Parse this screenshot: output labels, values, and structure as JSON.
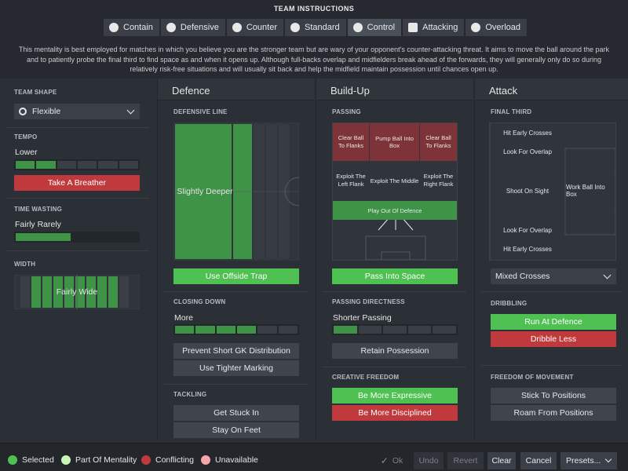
{
  "title": "TEAM INSTRUCTIONS",
  "tabs": [
    {
      "label": "Contain"
    },
    {
      "label": "Defensive"
    },
    {
      "label": "Counter"
    },
    {
      "label": "Standard"
    },
    {
      "label": "Control"
    },
    {
      "label": "Attacking"
    },
    {
      "label": "Overload"
    }
  ],
  "description_lines": [
    "This mentality is best employed for matches in which you believe you are the stronger team but are wary of your opponent's counter-attacking threat. It aims to move the ball around the park",
    "and to patiently probe the final third to find space as and when it opens up. Although full-backs overlap and midfielders break ahead of the forwards, they will generally only do so during",
    "relatively risk-free situations and will usually sit back and help the midfield maintain possession until chances open up."
  ],
  "left": {
    "team_shape_label": "TEAM SHAPE",
    "team_shape_value": "Flexible",
    "tempo_label": "TEMPO",
    "tempo_value": "Lower",
    "tempo_level": 2,
    "tempo_segments": 6,
    "tempo_button": "Take A Breather",
    "time_wasting_label": "TIME WASTING",
    "time_wasting_value": "Fairly Rarely",
    "time_wasting_level": 0.45,
    "width_label": "WIDTH",
    "width_value": "Fairly Wide"
  },
  "defence": {
    "header": "Defence",
    "line_label": "DEFENSIVE LINE",
    "line_value": "Slightly Deeper",
    "offside_button": "Use Offside Trap",
    "closing_label": "CLOSING DOWN",
    "closing_value": "More",
    "closing_level": 4,
    "closing_segments": 6,
    "buttons": [
      "Prevent Short GK Distribution",
      "Use Tighter Marking"
    ],
    "tackling_label": "TACKLING",
    "tackling_buttons": [
      "Get Stuck In",
      "Stay On Feet"
    ]
  },
  "buildup": {
    "header": "Build-Up",
    "passing_label": "PASSING",
    "zones_top": [
      "Clear Ball To Flanks",
      "Pump Ball Into Box",
      "Clear Ball To Flanks"
    ],
    "zones_mid": [
      "Exploit The Left Flank",
      "Exploit The Middle",
      "Exploit The Right Flank"
    ],
    "zone_bottom": "Play Out Of Defence",
    "space_button": "Pass Into Space",
    "directness_label": "PASSING DIRECTNESS",
    "directness_value": "Shorter Passing",
    "directness_level": 1,
    "directness_segments": 5,
    "retain_button": "Retain Possession",
    "creative_label": "CREATIVE FREEDOM",
    "expressive_button": "Be More Expressive",
    "disciplined_button": "Be More Disciplined"
  },
  "attack": {
    "header": "Attack",
    "final_third_label": "FINAL THIRD",
    "zones": [
      "Hit Early Crosses",
      "Look For Overlap",
      "Shoot On Sight",
      "Work Ball Into Box",
      "Look For Overlap",
      "Hit Early Crosses"
    ],
    "crosses_value": "Mixed Crosses",
    "dribbling_label": "DRIBBLING",
    "run_button": "Run At Defence",
    "dribble_less_button": "Dribble Less",
    "freedom_label": "FREEDOM OF MOVEMENT",
    "freedom_buttons": [
      "Stick To Positions",
      "Roam From Positions"
    ]
  },
  "footer": {
    "legend": [
      {
        "label": "Selected",
        "color": "#4fc152"
      },
      {
        "label": "Part Of Mentality",
        "color": "#c9f5b7"
      },
      {
        "label": "Conflicting",
        "color": "#c0393d"
      },
      {
        "label": "Unavailable",
        "color": "#f4a6a8"
      }
    ],
    "ok": "Ok",
    "undo": "Undo",
    "revert": "Revert",
    "clear": "Clear",
    "cancel": "Cancel",
    "presets": "Presets..."
  },
  "colors": {
    "accent_green": "#4fc152",
    "conflict_red": "#c0393d",
    "bar_green": "#3e9346",
    "zone_red": "#7d3337"
  }
}
